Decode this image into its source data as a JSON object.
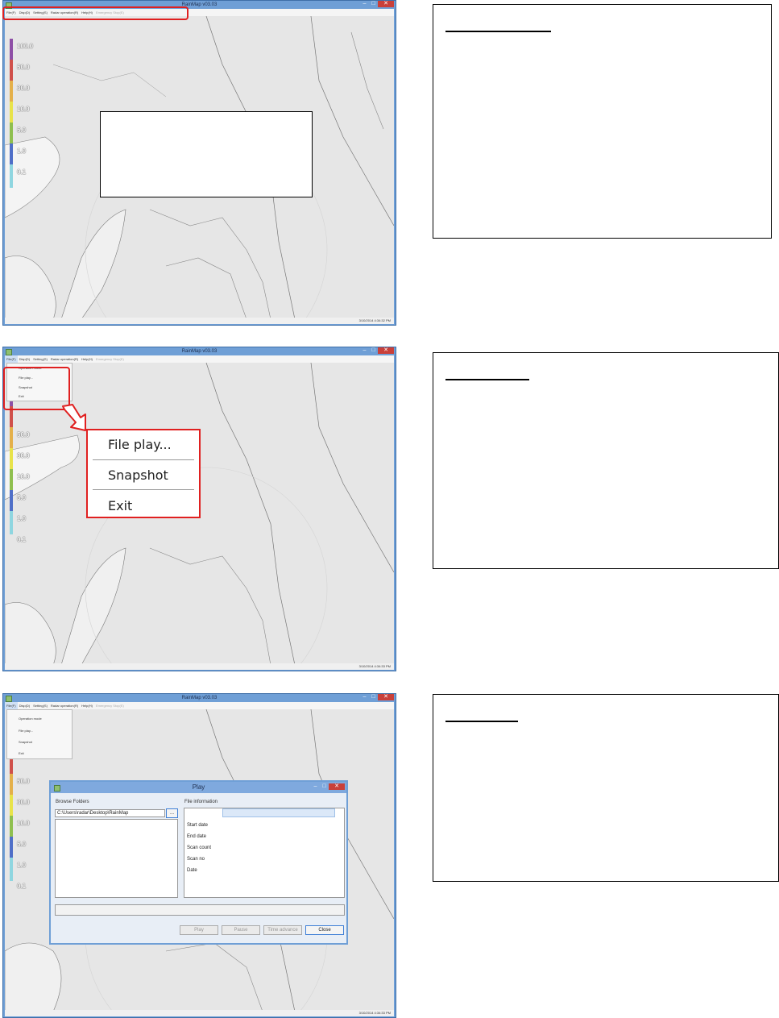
{
  "app": {
    "title": "RainMap v03.03",
    "minimize_icon": "minimize-icon",
    "maximize_icon": "maximize-icon",
    "close_icon": "close-icon"
  },
  "menu": {
    "file": "File(F)",
    "disp": "Disp(D)",
    "setting": "Setting(S)",
    "radar_operation": "Radar operation(R)",
    "help": "Help(H)",
    "emergency": "Emergency Stop(E)"
  },
  "file_menu": {
    "items": [
      "Operation mode",
      "File play...",
      "Snapshot",
      "Exit"
    ]
  },
  "legend": {
    "labels": [
      "100.0",
      "50.0",
      "30.0",
      "10.0",
      "5.0",
      "1.0",
      "0.1"
    ],
    "colors": [
      "#8e4fa6",
      "#d0504a",
      "#e4b04a",
      "#e8e34a",
      "#8fbf4f",
      "#4f6fc8",
      "#8fd6e0"
    ]
  },
  "status": {
    "timestamp_1": "3/10/2014 4:34:32 PM",
    "timestamp_2": "3/10/2014 4:34:33 PM",
    "timestamp_3": "3/10/2014 4:34:33 PM"
  },
  "popout": {
    "items": [
      "File play...",
      "Snapshot",
      "Exit"
    ]
  },
  "play_dialog": {
    "title": "Play",
    "browse_label": "Browse Folders",
    "path_value": "C:\\Users\\radar\\Desktop\\RainMap",
    "browse_button": "...",
    "info_label": "File information",
    "info_rows": [
      "Start date",
      "End date",
      "Scan count",
      "Scan no",
      "Date"
    ],
    "buttons": [
      "Play",
      "Pause",
      "Time advance",
      "Close"
    ]
  },
  "colors": {
    "highlight": "#e02020",
    "titlebar": "#6f9fd6",
    "map": "#e6e6e6"
  }
}
